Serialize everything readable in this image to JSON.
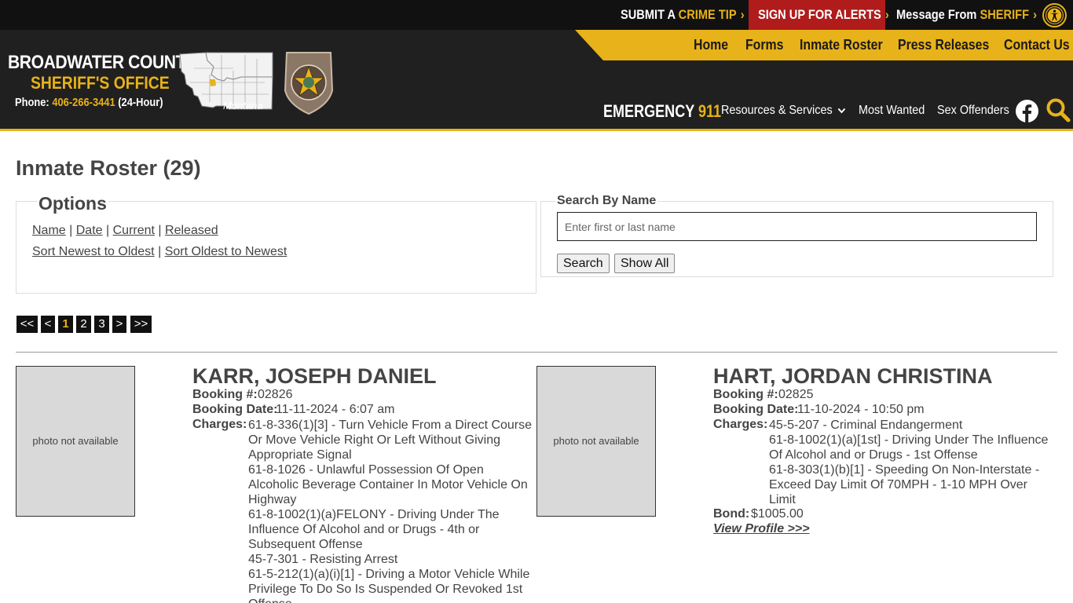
{
  "topbar": {
    "tip_prefix": "SUBMIT A",
    "tip_highlight": "CRIME TIP",
    "alerts": "SIGN UP FOR ALERTS",
    "sheriff_prefix": "Message From",
    "sheriff_highlight": "SHERIFF",
    "chevron": "›"
  },
  "brand": {
    "line1": "BROADWATER COUNTY",
    "line2": "SHERIFF'S OFFICE",
    "phone_label": "Phone:",
    "phone_number": "406-266-3441",
    "phone_suffix": "(24-Hour)",
    "map_label": "Montana"
  },
  "nav": {
    "items": [
      "Home",
      "Forms",
      "Inmate Roster",
      "Press Releases",
      "Contact Us"
    ]
  },
  "subnav": {
    "emergency_label": "EMERGENCY",
    "emergency_number": "911",
    "resources": "Resources & Services",
    "most_wanted": "Most Wanted",
    "sex_offenders": "Sex Offenders"
  },
  "page": {
    "title": "Inmate Roster (29)"
  },
  "options": {
    "legend": "Options",
    "sort_links": [
      "Name",
      "Date",
      "Current",
      "Released"
    ],
    "order_links": [
      "Sort Newest to Oldest",
      "Sort Oldest to Newest"
    ],
    "separator": "|"
  },
  "search": {
    "legend": "Search By Name",
    "placeholder": "Enter first or last name",
    "value": "",
    "search_button": "Search",
    "show_all_button": "Show All"
  },
  "pager": {
    "items": [
      "<<",
      "<",
      "1",
      "2",
      "3",
      ">",
      ">>"
    ],
    "active": "1"
  },
  "labels": {
    "booking_num": "Booking #:",
    "booking_date": "Booking Date:",
    "charges": "Charges:",
    "bond": "Bond:",
    "view_profile": "View Profile >>>",
    "photo_na": "photo not available"
  },
  "inmates": [
    {
      "name": "KARR, JOSEPH DANIEL",
      "booking_num": "02826",
      "booking_date": "11-11-2024 - 6:07 am",
      "charges": [
        "61-8-336(1)[3] - Turn Vehicle From a Direct Course",
        "Or Move Vehicle Right Or Left Without Giving",
        "Appropriate Signal",
        "61-8-1026 - Unlawful Possession Of Open",
        "Alcoholic Beverage Container In Motor Vehicle On",
        "Highway",
        "61-8-1002(1)(a)FELONY - Driving Under The",
        "Influence Of Alcohol and or Drugs - 4th or",
        "Subsequent Offense",
        "45-7-301 - Resisting Arrest",
        "61-5-212(1)(a)(i)[1] - Driving a Motor Vehicle While",
        "Privilege To Do So Is Suspended Or Revoked 1st",
        "Offense"
      ]
    },
    {
      "name": "HART, JORDAN CHRISTINA",
      "booking_num": "02825",
      "booking_date": "11-10-2024 - 10:50 pm",
      "charges": [
        "45-5-207 - Criminal Endangerment",
        "61-8-1002(1)(a)[1st] - Driving Under The Influence",
        "Of Alcohol and or Drugs - 1st Offense",
        "61-8-303(1)(b)[1] - Speeding On Non-Interstate -",
        "Exceed Day Limit Of 70MPH - 1-10 MPH Over",
        "Limit"
      ],
      "bond": "$1005.00"
    }
  ]
}
